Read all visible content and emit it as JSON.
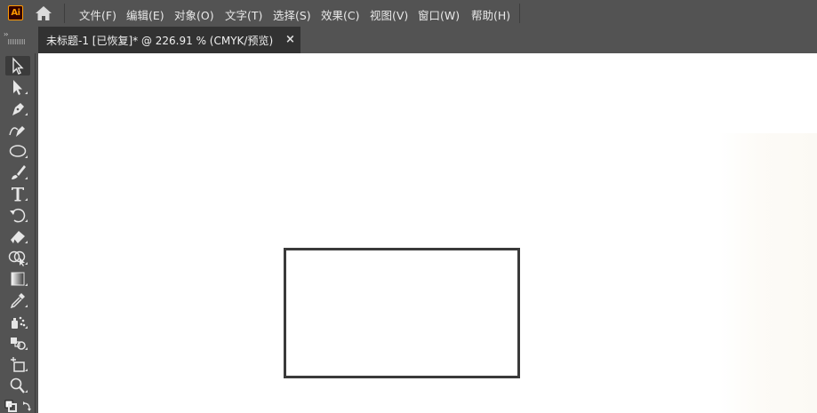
{
  "app": {
    "logo_text": "Ai",
    "logo_colors": {
      "bg": "#330000",
      "accent": "#ff9a00"
    }
  },
  "menu": {
    "items": [
      {
        "label": "文件(F)"
      },
      {
        "label": "编辑(E)"
      },
      {
        "label": "对象(O)"
      },
      {
        "label": "文字(T)"
      },
      {
        "label": "选择(S)"
      },
      {
        "label": "效果(C)"
      },
      {
        "label": "视图(V)"
      },
      {
        "label": "窗口(W)"
      },
      {
        "label": "帮助(H)"
      }
    ]
  },
  "document_tab": {
    "title": "未标题-1 [已恢复]* @ 226.91 % (CMYK/预览)",
    "close_glyph": "×"
  },
  "panel_grip_glyph": "››",
  "toolbar": {
    "tools": [
      {
        "name": "selection-tool",
        "icon": "arrow-icon",
        "active": true
      },
      {
        "name": "direct-selection-tool",
        "icon": "direct-arrow-icon"
      },
      {
        "name": "pen-tool",
        "icon": "pen-icon"
      },
      {
        "name": "curvature-tool",
        "icon": "curvature-pen-icon"
      },
      {
        "name": "ellipse-tool",
        "icon": "ellipse-icon"
      },
      {
        "name": "paintbrush-tool",
        "icon": "brush-icon"
      },
      {
        "name": "type-tool",
        "icon": "type-icon",
        "glyph": "T"
      },
      {
        "name": "rotate-tool",
        "icon": "rotate-icon"
      },
      {
        "name": "eraser-tool",
        "icon": "eraser-icon"
      },
      {
        "name": "shape-builder-tool",
        "icon": "shape-builder-icon"
      },
      {
        "name": "gradient-tool",
        "icon": "gradient-icon"
      },
      {
        "name": "eyedropper-tool",
        "icon": "eyedropper-icon"
      },
      {
        "name": "symbol-sprayer-tool",
        "icon": "symbol-sprayer-icon"
      },
      {
        "name": "blend-tool",
        "icon": "blend-icon"
      },
      {
        "name": "artboard-tool",
        "icon": "artboard-icon"
      },
      {
        "name": "zoom-tool",
        "icon": "zoom-icon"
      }
    ]
  },
  "colors": {
    "chrome": "#535353",
    "tab_active": "#323232",
    "canvas": "#ffffff",
    "rectangle_stroke": "#3a3a3a"
  }
}
